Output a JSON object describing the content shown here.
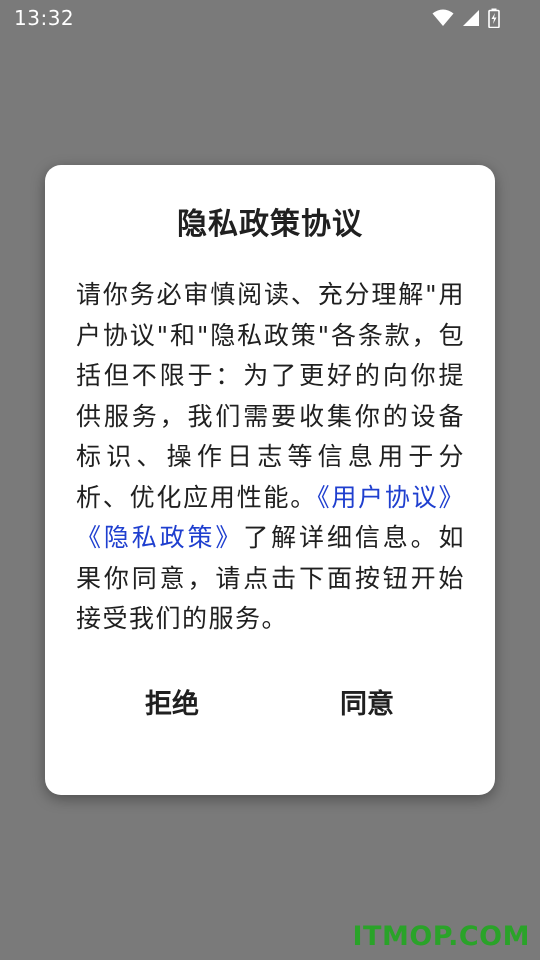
{
  "status_bar": {
    "time": "13:32",
    "icons": [
      "wifi-icon",
      "signal-icon",
      "battery-charging-icon"
    ]
  },
  "dialog": {
    "title": "隐私政策协议",
    "body_text": "请你务必审慎阅读、充分理解\"用户协议\"和\"隐私政策\"各条款，包括但不限于：为了更好的向你提供服务，我们需要收集你的设备标识、操作日志等信息用于分析、优化应用性能。",
    "user_agreement_link": "《用户协议》",
    "privacy_policy_link": "《隐私政策》",
    "body_text_after": "了解详细信息。如果你同意，请点击下面按钮开始接受我们的服务。",
    "reject_label": "拒绝",
    "agree_label": "同意"
  },
  "watermark": "ITMOP.COM",
  "colors": {
    "overlay": "#7a7a7a",
    "dialog_bg": "#ffffff",
    "text": "#202020",
    "link": "#1f3fcf",
    "watermark": "#2aa329"
  }
}
